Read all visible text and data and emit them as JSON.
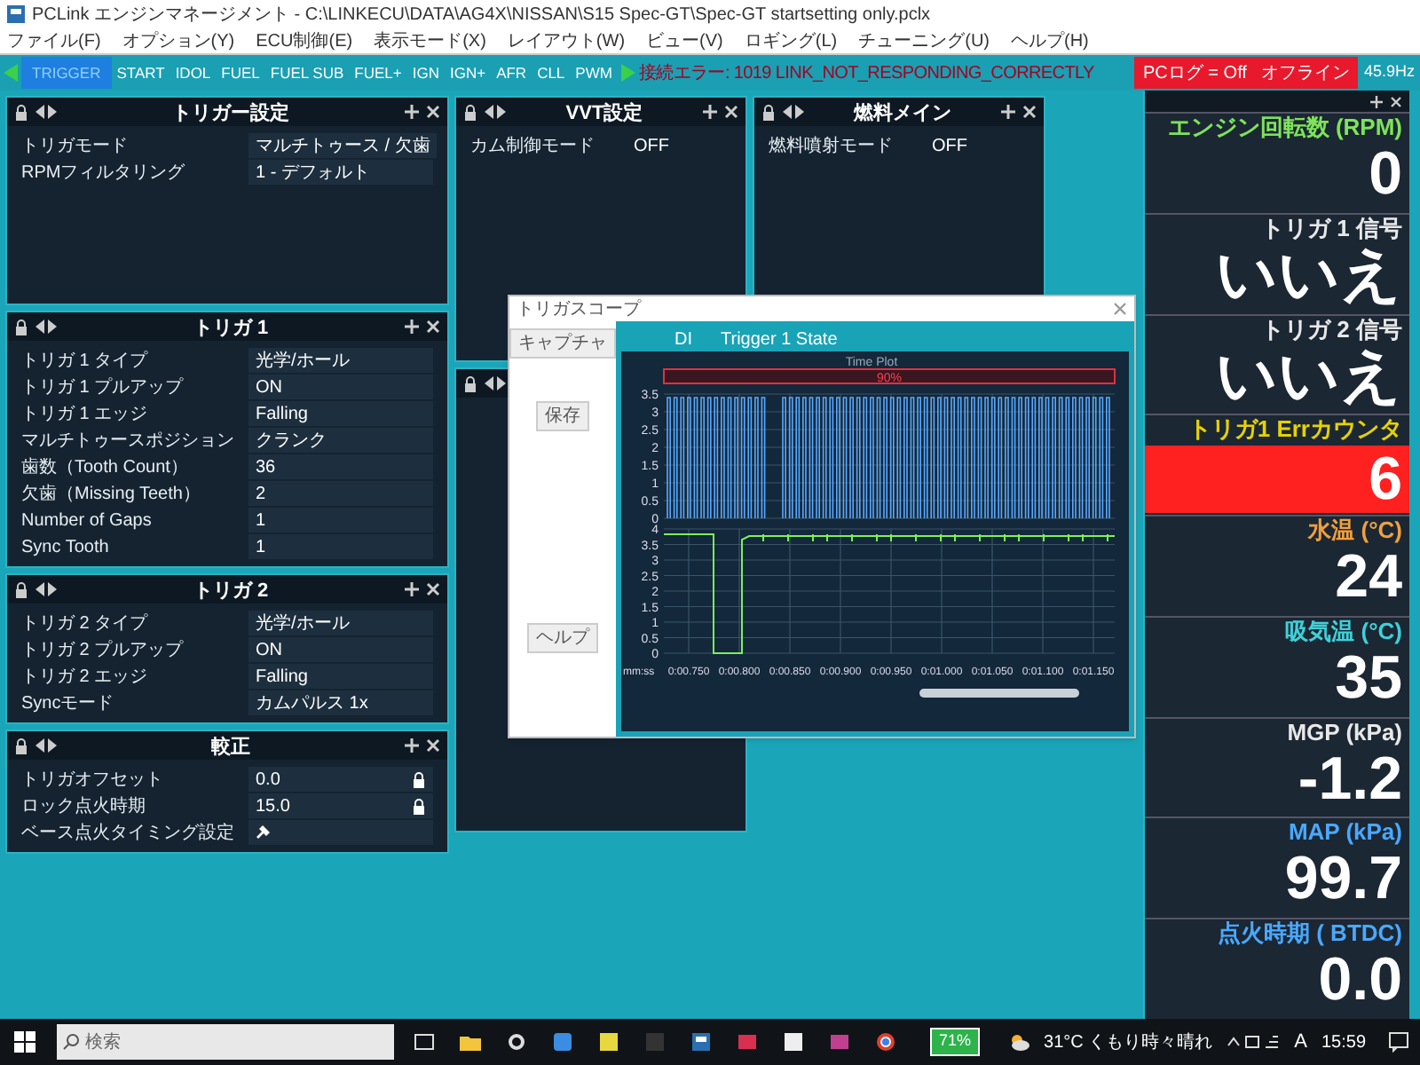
{
  "window": {
    "title": "PCLink エンジンマネージメント - C:\\LINKECU\\DATA\\AG4X\\NISSAN\\S15 Spec-GT\\Spec-GT startsetting only.pclx"
  },
  "menu": [
    "ファイル(F)",
    "オプション(Y)",
    "ECU制御(E)",
    "表示モード(X)",
    "レイアウト(W)",
    "ビュー(V)",
    "ロギング(L)",
    "チューニング(U)",
    "ヘルプ(H)"
  ],
  "toolbar": {
    "tabs": [
      {
        "label": "TRIGGER",
        "selected": true
      },
      {
        "label": "START",
        "selected": false
      },
      {
        "label": "IDOL",
        "selected": false
      },
      {
        "label": "FUEL",
        "selected": false
      },
      {
        "label": "FUEL SUB",
        "selected": false
      },
      {
        "label": "FUEL+",
        "selected": false
      },
      {
        "label": "IGN",
        "selected": false
      },
      {
        "label": "IGN+",
        "selected": false
      },
      {
        "label": "AFR",
        "selected": false
      },
      {
        "label": "CLL",
        "selected": false
      },
      {
        "label": "PWM",
        "selected": false
      }
    ],
    "error": "接続エラー: 1019 LINK_NOT_RESPONDING_CORRECTLY",
    "pc_log": "PCログ = Off",
    "connection": "オフライン",
    "rate": "45.9Hz"
  },
  "columns": [
    [
      {
        "title": "トリガー設定",
        "rows": [
          {
            "label": "トリガモード",
            "value": "マルチトゥース / 欠歯"
          },
          {
            "label": "RPMフィルタリング",
            "value": "1 - デフォルト"
          }
        ]
      },
      {
        "title": "トリガ 1",
        "rows": [
          {
            "label": "トリガ 1 タイプ",
            "value": "光学/ホール"
          },
          {
            "label": "トリガ 1 プルアップ",
            "value": "ON"
          },
          {
            "label": "トリガ 1 エッジ",
            "value": "Falling"
          },
          {
            "label": "マルチトゥースポジション",
            "value": "クランク"
          },
          {
            "label": "歯数（Tooth Count）",
            "value": "36"
          },
          {
            "label": "欠歯（Missing Teeth）",
            "value": "2"
          },
          {
            "label": "Number of Gaps",
            "value": "1"
          },
          {
            "label": "Sync Tooth",
            "value": "1"
          }
        ]
      },
      {
        "title": "トリガ 2",
        "rows": [
          {
            "label": "トリガ 2 タイプ",
            "value": "光学/ホール"
          },
          {
            "label": "トリガ 2 プルアップ",
            "value": "ON"
          },
          {
            "label": "トリガ 2 エッジ",
            "value": "Falling"
          },
          {
            "label": "Syncモード",
            "value": "カムパルス 1x"
          }
        ]
      },
      {
        "title": "較正",
        "rows": [
          {
            "label": "トリガオフセット",
            "value": "0.0",
            "kind": "locked"
          },
          {
            "label": "ロック点火時期",
            "value": "15.0",
            "kind": "locked"
          },
          {
            "label": "ベース点火タイミング設定",
            "kind": "tool"
          }
        ]
      }
    ],
    [
      {
        "title": "VVT設定",
        "rows": [
          {
            "label": "カム制御モード",
            "value": "OFF"
          }
        ]
      },
      {}
    ],
    [
      {
        "title": "燃料メイン",
        "rows": [
          {
            "label": "燃料噴射モード",
            "value": "OFF"
          }
        ]
      }
    ]
  ],
  "scope": {
    "title": "トリガスコープ",
    "buttons": [
      "キャプチャ",
      "保存",
      "ヘルプ"
    ],
    "tabs": [
      "DI",
      "Trigger 1 State"
    ],
    "plot_title": "Time Plot",
    "marker": "90%",
    "upper_yticks": [
      "3.5",
      "3",
      "2.5",
      "2",
      "1.5",
      "1",
      "0.5",
      "0"
    ],
    "lower_yticks": [
      "4",
      "3.5",
      "3",
      "2.5",
      "2",
      "1.5",
      "1",
      "0.5",
      "0"
    ],
    "x_unit": "mm:ss",
    "xticks": [
      "0:00.750",
      "0:00.800",
      "0:00.850",
      "0:00.900",
      "0:00.950",
      "0:01.000",
      "0:01.050",
      "0:01.100",
      "0:01.150"
    ]
  },
  "gauges": [
    {
      "label": "エンジン回転数 (RPM)",
      "value": "0",
      "color": "#7ee35a",
      "alert": false
    },
    {
      "label": "トリガ 1 信号",
      "value": "いいえ",
      "color": "#e8e8e8",
      "alert": false
    },
    {
      "label": "トリガ 2 信号",
      "value": "いいえ",
      "color": "#e8e8e8",
      "alert": false
    },
    {
      "label": "トリガ1 Errカウンタ",
      "value": "6",
      "color": "#e6d200",
      "alert": true
    },
    {
      "label": "水温 (°C)",
      "value": "24",
      "color": "#f0a040",
      "alert": false
    },
    {
      "label": "吸気温 (°C)",
      "value": "35",
      "color": "#3fd0d8",
      "alert": false
    },
    {
      "label": "MGP (kPa)",
      "value": "-1.2",
      "color": "#e8e8e8",
      "alert": false
    },
    {
      "label": "MAP (kPa)",
      "value": "99.7",
      "color": "#4aa8ff",
      "alert": false
    },
    {
      "label": "点火時期 ( BTDC)",
      "value": "0.0",
      "color": "#4aa8ff",
      "alert": false
    }
  ],
  "taskbar": {
    "search": {
      "placeholder": "検索"
    },
    "battery": "71%",
    "weather": "31°C くもり時々晴れ",
    "ime": "A",
    "time": "15:59"
  }
}
